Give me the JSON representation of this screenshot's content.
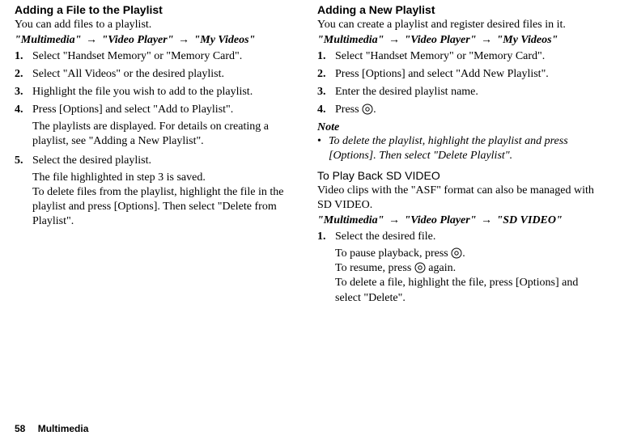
{
  "left": {
    "heading": "Adding a File to the Playlist",
    "intro": "You can add files to a playlist.",
    "crumb1": "\"Multimedia\"",
    "crumb2": "\"Video Player\"",
    "crumb3": "\"My Videos\"",
    "step1": "Select \"Handset Memory\" or \"Memory Card\".",
    "step2": "Select \"All Videos\" or the desired playlist.",
    "step3": "Highlight the file you wish to add to the playlist.",
    "step4": "Press [Options] and select \"Add to Playlist\".",
    "step4_sub": "The playlists are displayed. For details on creating a playlist, see \"Adding a New Playlist\".",
    "step5": "Select the desired playlist.",
    "step5_sub": "The file highlighted in step 3 is saved.\nTo delete files from the playlist, highlight the file in the playlist and press [Options]. Then select \"Delete from Playlist\"."
  },
  "right": {
    "heading": "Adding a New Playlist",
    "intro": "You can create a playlist and register desired files in it.",
    "crumb1": "\"Multimedia\"",
    "crumb2": "\"Video Player\"",
    "crumb3": "\"My Videos\"",
    "step1": "Select \"Handset Memory\" or \"Memory Card\".",
    "step2": "Press [Options] and select \"Add New Playlist\".",
    "step3": "Enter the desired playlist name.",
    "step4_pre": "Press ",
    "step4_post": ".",
    "note_label": "Note",
    "note_body": "To delete the playlist, highlight the playlist and press [Options]. Then select \"Delete Playlist\".",
    "sd_heading": "To Play Back SD VIDEO",
    "sd_intro": "Video clips with the \"ASF\" format can also be managed with SD VIDEO.",
    "sd_crumb1": "\"Multimedia\"",
    "sd_crumb2": "\"Video Player\"",
    "sd_crumb3": "\"SD VIDEO\"",
    "sd_step1": "Select the desired file.",
    "sd_sub_line1_pre": "To pause playback, press ",
    "sd_sub_line1_post": ".",
    "sd_sub_line2_pre": "To resume, press ",
    "sd_sub_line2_post": " again.",
    "sd_sub_line3": "To delete a file, highlight the file, press [Options] and select \"Delete\"."
  },
  "nums": {
    "n1": "1.",
    "n2": "2.",
    "n3": "3.",
    "n4": "4.",
    "n5": "5."
  },
  "arrow": "→",
  "bullet": "•",
  "footer": {
    "page": "58",
    "section": "Multimedia"
  }
}
